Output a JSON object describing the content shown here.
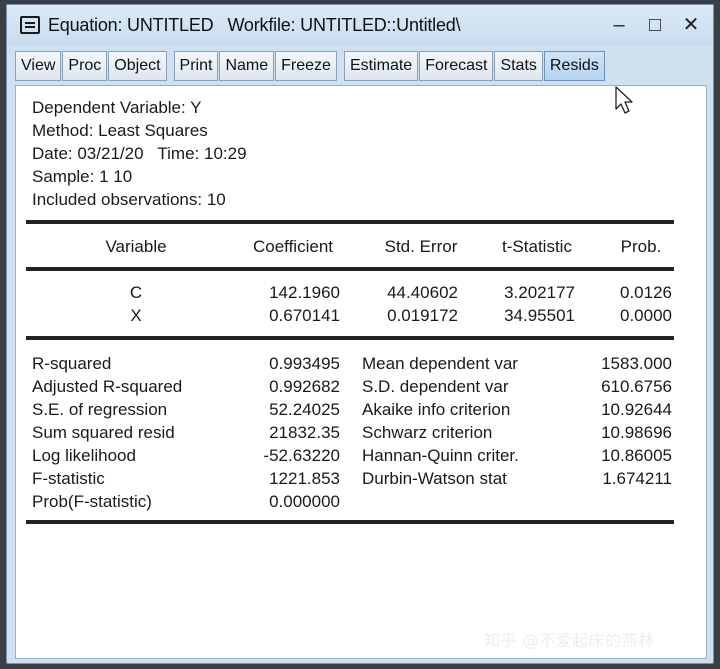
{
  "window": {
    "title": "Equation: UNTITLED",
    "workfile": "Workfile: UNTITLED::Untitled\\",
    "controls": [
      "–",
      "□",
      "✕"
    ]
  },
  "toolbar": {
    "group1": [
      "View",
      "Proc",
      "Object"
    ],
    "group2": [
      "Print",
      "Name",
      "Freeze"
    ],
    "group3": [
      "Estimate",
      "Forecast",
      "Stats",
      "Resids"
    ]
  },
  "header": {
    "dependent": "Dependent Variable: Y",
    "method": "Method: Least Squares",
    "date": "Date: 03/21/20   Time: 10:29",
    "sample": "Sample: 1 10",
    "included": "Included observations: 10"
  },
  "coef_table": {
    "columns": [
      "Variable",
      "Coefficient",
      "Std. Error",
      "t-Statistic",
      "Prob."
    ],
    "rows": [
      [
        "C",
        "142.1960",
        "44.40602",
        "3.202177",
        "0.0126"
      ],
      [
        "X",
        "0.670141",
        "0.019172",
        "34.95501",
        "0.0000"
      ]
    ]
  },
  "stats": {
    "left": [
      [
        "R-squared",
        "0.993495"
      ],
      [
        "Adjusted R-squared",
        "0.992682"
      ],
      [
        "S.E. of regression",
        "52.24025"
      ],
      [
        "Sum squared resid",
        "21832.35"
      ],
      [
        "Log likelihood",
        "-52.63220"
      ],
      [
        "F-statistic",
        "1221.853"
      ],
      [
        "Prob(F-statistic)",
        "0.000000"
      ]
    ],
    "right": [
      [
        "Mean dependent var",
        "1583.000"
      ],
      [
        "S.D. dependent var",
        "610.6756"
      ],
      [
        "Akaike info criterion",
        "10.92644"
      ],
      [
        "Schwarz criterion",
        "10.98696"
      ],
      [
        "Hannan-Quinn criter.",
        "10.86005"
      ],
      [
        "Durbin-Watson stat",
        "1.674211"
      ]
    ]
  },
  "watermark": "知乎 @不爱起床的燕林",
  "icons": [
    "system-menu-icon",
    "minimize-icon",
    "maximize-icon",
    "close-icon",
    "mouse-cursor-icon"
  ]
}
